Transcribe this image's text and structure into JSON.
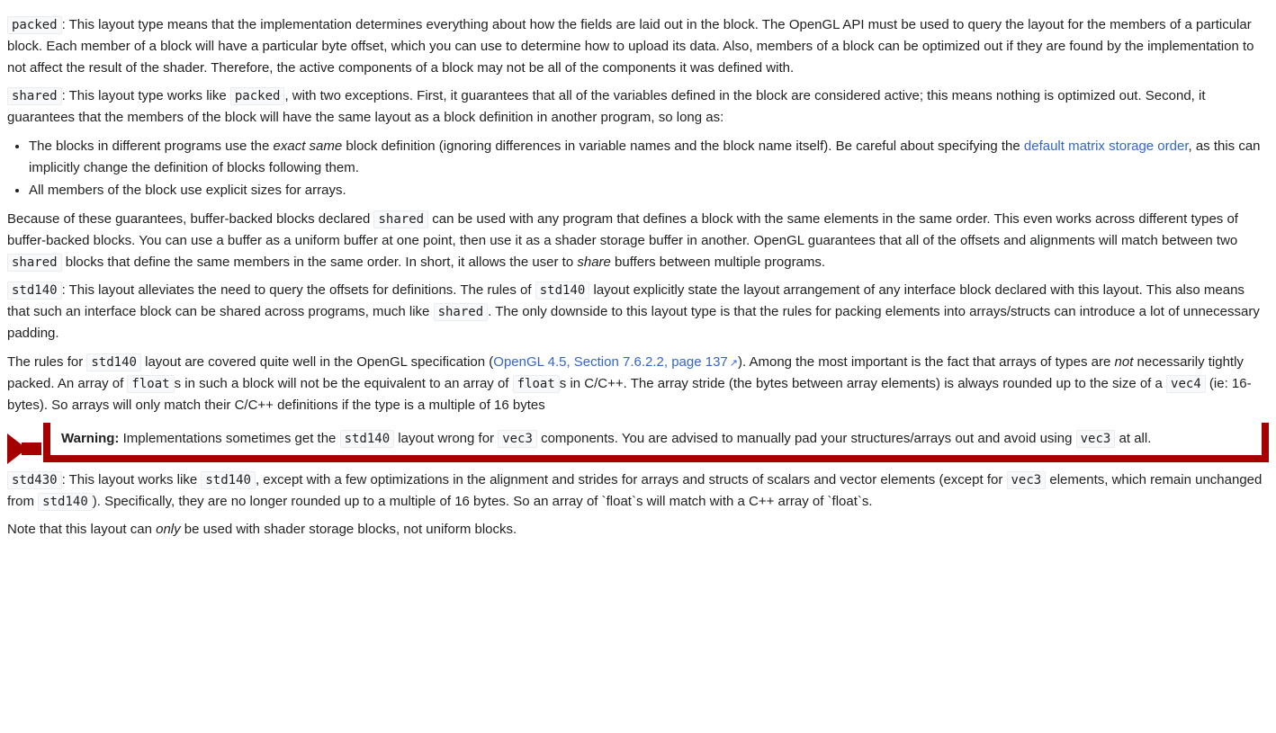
{
  "p_packed": {
    "term": "packed",
    "text": ": This layout type means that the implementation determines everything about how the fields are laid out in the block. The OpenGL API must be used to query the layout for the members of a particular block. Each member of a block will have a particular byte offset, which you can use to determine how to upload its data. Also, members of a block can be optimized out if they are found by the implementation to not affect the result of the shader. Therefore, the active components of a block may not be all of the components it was defined with."
  },
  "p_shared": {
    "term": "shared",
    "t1": ": This layout type works like ",
    "packed": "packed",
    "t2": ", with two exceptions. First, it guarantees that all of the variables defined in the block are considered active; this means nothing is optimized out. Second, it guarantees that the members of the block will have the same layout as a block definition in another program, so long as:"
  },
  "ul_shared": {
    "li1_a": "The blocks in different programs use the ",
    "li1_em": "exact same",
    "li1_b": " block definition (ignoring differences in variable names and the block name itself). Be careful about specifying the ",
    "li1_link": "default matrix storage order",
    "li1_c": ", as this can implicitly change the definition of blocks following them.",
    "li2": "All members of the block use explicit sizes for arrays."
  },
  "p_because": {
    "t1": "Because of these guarantees, buffer-backed blocks declared ",
    "shared1": "shared",
    "t2": " can be used with any program that defines a block with the same elements in the same order. This even works across different types of buffer-backed blocks. You can use a buffer as a uniform buffer at one point, then use it as a shader storage buffer in another. OpenGL guarantees that all of the offsets and alignments will match between two ",
    "shared2": "shared",
    "t3": " blocks that define the same members in the same order. In short, it allows the user to ",
    "em": "share",
    "t4": " buffers between multiple programs."
  },
  "p_std140": {
    "term": "std140",
    "t1": ": This layout alleviates the need to query the offsets for definitions. The rules of ",
    "c1": "std140",
    "t2": " layout explicitly state the layout arrangement of any interface block declared with this layout. This also means that such an interface block can be shared across programs, much like ",
    "c2": "shared",
    "t3": ". The only downside to this layout type is that the rules for packing elements into arrays/structs can introduce a lot of unnecessary padding."
  },
  "p_rules": {
    "t1": "The rules for ",
    "c1": "std140",
    "t2": " layout are covered quite well in the OpenGL specification (",
    "link": "OpenGL 4.5, Section 7.6.2.2, page 137",
    "t3": "). Among the most important is the fact that arrays of types are ",
    "em": "not",
    "t4": " necessarily tightly packed. An array of ",
    "c2": "float",
    "t5": "s in such a block will not be the equivalent to an array of ",
    "c3": "float",
    "t6": "s in C/C++. The array stride (the bytes between array elements) is always rounded up to the size of a ",
    "c4": "vec4",
    "t7": " (ie: 16-bytes). So arrays will only match their C/C++ definitions if the type is a multiple of 16 bytes"
  },
  "warning": {
    "label": "Warning:",
    "t1": " Implementations sometimes get the ",
    "c1": "std140",
    "t2": " layout wrong for ",
    "c2": "vec3",
    "t3": " components. You are advised to manually pad your structures/arrays out and avoid using ",
    "c3": "vec3",
    "t4": " at all."
  },
  "p_std430": {
    "term": "std430",
    "t1": ": This layout works like ",
    "c1": "std140",
    "t2": ", except with a few optimizations in the alignment and strides for arrays and structs of scalars and vector elements (except for ",
    "c2": "vec3",
    "t3": " elements, which remain unchanged from ",
    "c3": "std140",
    "t4": "). Specifically, they are no longer rounded up to a multiple of 16 bytes. So an array of `float`s will match with a C++ array of `float`s."
  },
  "p_note": {
    "t1": "Note that this layout can ",
    "em": "only",
    "t2": " be used with shader storage blocks, not uniform blocks."
  }
}
